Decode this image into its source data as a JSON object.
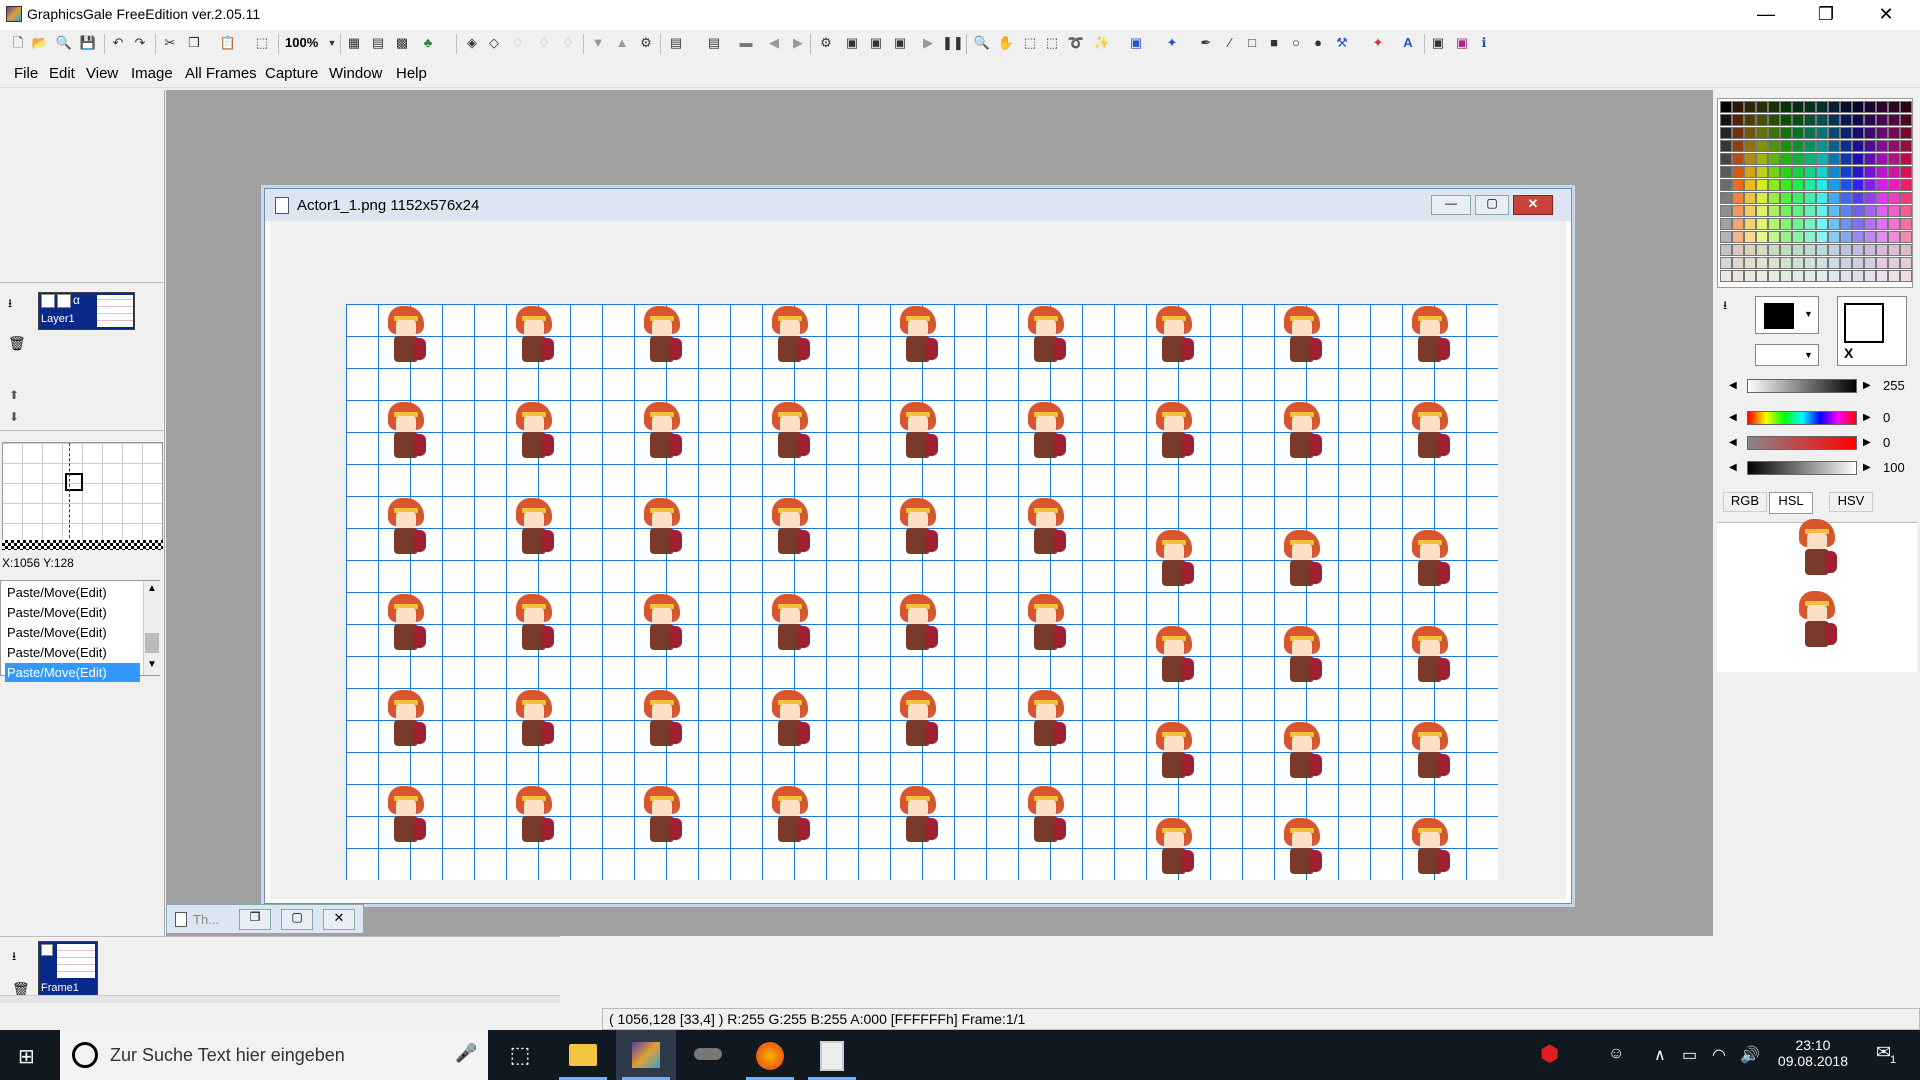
{
  "window": {
    "title": "GraphicsGale FreeEdition ver.2.05.11",
    "min_icon": "minimize-icon",
    "max_icon": "maximize-icon",
    "close_icon": "close-icon"
  },
  "toolbar": {
    "zoom": "100%"
  },
  "menu": [
    "File",
    "Edit",
    "View",
    "Image",
    "All Frames",
    "Capture",
    "Window",
    "Help"
  ],
  "left": {
    "layer_name": "Layer1",
    "alpha_label": "α",
    "coords": "X:1056 Y:128",
    "history": [
      "Paste/Move(Edit)",
      "Paste/Move(Edit)",
      "Paste/Move(Edit)",
      "Paste/Move(Edit)",
      "Paste/Move(Edit)"
    ]
  },
  "document": {
    "title": "Actor1_1.png 1152x576x24"
  },
  "thumb_window": {
    "title": "Th..."
  },
  "frames": {
    "frame_label": "Frame1"
  },
  "color": {
    "swap_label": "X",
    "slider_values": [
      "255",
      "0",
      "0",
      "100"
    ],
    "tabs": [
      "RGB",
      "HSL",
      "HSV"
    ]
  },
  "status": {
    "text": "( 1056,128 [33,4] ) R:255 G:255 B:255 A:000  [FFFFFFh]  Frame:1/1"
  },
  "taskbar": {
    "search_placeholder": "Zur Suche Text hier eingeben",
    "time": "23:10",
    "date": "09.08.2018",
    "notification_count": "1"
  },
  "colors": {
    "grid": "#1e78e0",
    "taskbar": "#101820",
    "workspace": "#a0a0a0",
    "selection": "#3399ff"
  }
}
